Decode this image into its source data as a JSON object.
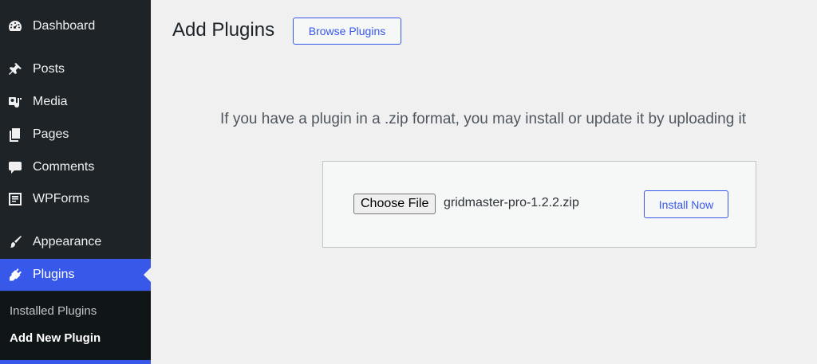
{
  "sidebar": {
    "items": [
      {
        "label": "Dashboard",
        "icon": "dashboard-icon"
      },
      {
        "label": "Posts",
        "icon": "pin-icon"
      },
      {
        "label": "Media",
        "icon": "media-icon"
      },
      {
        "label": "Pages",
        "icon": "pages-icon"
      },
      {
        "label": "Comments",
        "icon": "comments-icon"
      },
      {
        "label": "WPForms",
        "icon": "forms-icon"
      },
      {
        "label": "Appearance",
        "icon": "brush-icon"
      },
      {
        "label": "Plugins",
        "icon": "plugin-icon",
        "active": true
      }
    ],
    "submenu": [
      {
        "label": "Installed Plugins"
      },
      {
        "label": "Add New Plugin",
        "current": true
      }
    ]
  },
  "main": {
    "title": "Add Plugins",
    "browse_button": "Browse Plugins",
    "upload_description": "If you have a plugin in a .zip format, you may install or update it by uploading it",
    "upload": {
      "choose_file_label": "Choose File",
      "file_name": "gridmaster-pro-1.2.2.zip",
      "install_button": "Install Now"
    }
  },
  "colors": {
    "sidebar_bg": "#1d2327",
    "accent": "#3858e9",
    "page_bg": "#f0f0f1"
  }
}
